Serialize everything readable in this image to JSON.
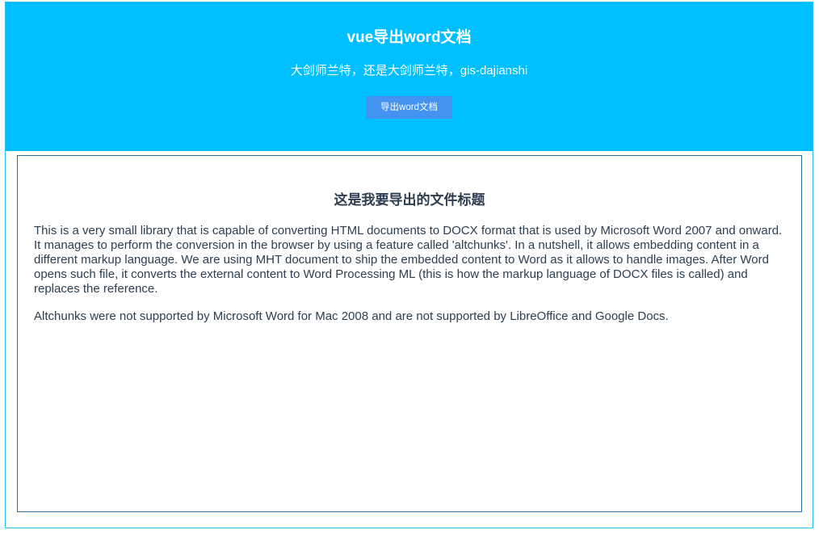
{
  "header": {
    "title": "vue导出word文档",
    "subtitle": "大剑师兰特，还是大剑师兰特，gis-dajianshi",
    "export_button_label": "导出word文档"
  },
  "document": {
    "title": "这是我要导出的文件标题",
    "paragraphs": [
      "This is a very small library that is capable of converting HTML documents to DOCX format that is used by Microsoft Word 2007 and onward. It manages to perform the conversion in the browser by using a feature called 'altchunks'. In a nutshell, it allows embedding content in a different markup language. We are using MHT document to ship the embedded content to Word as it allows to handle images. After Word opens such file, it converts the external content to Word Processing ML (this is how the markup language of DOCX files is called) and replaces the reference.",
      "Altchunks were not supported by Microsoft Word for Mac 2008 and are not supported by LibreOffice and Google Docs."
    ]
  },
  "colors": {
    "header_background": "#00bfff",
    "button_background": "#4593f0",
    "panel_border": "#2e6fa6",
    "text": "#2c3e50"
  }
}
